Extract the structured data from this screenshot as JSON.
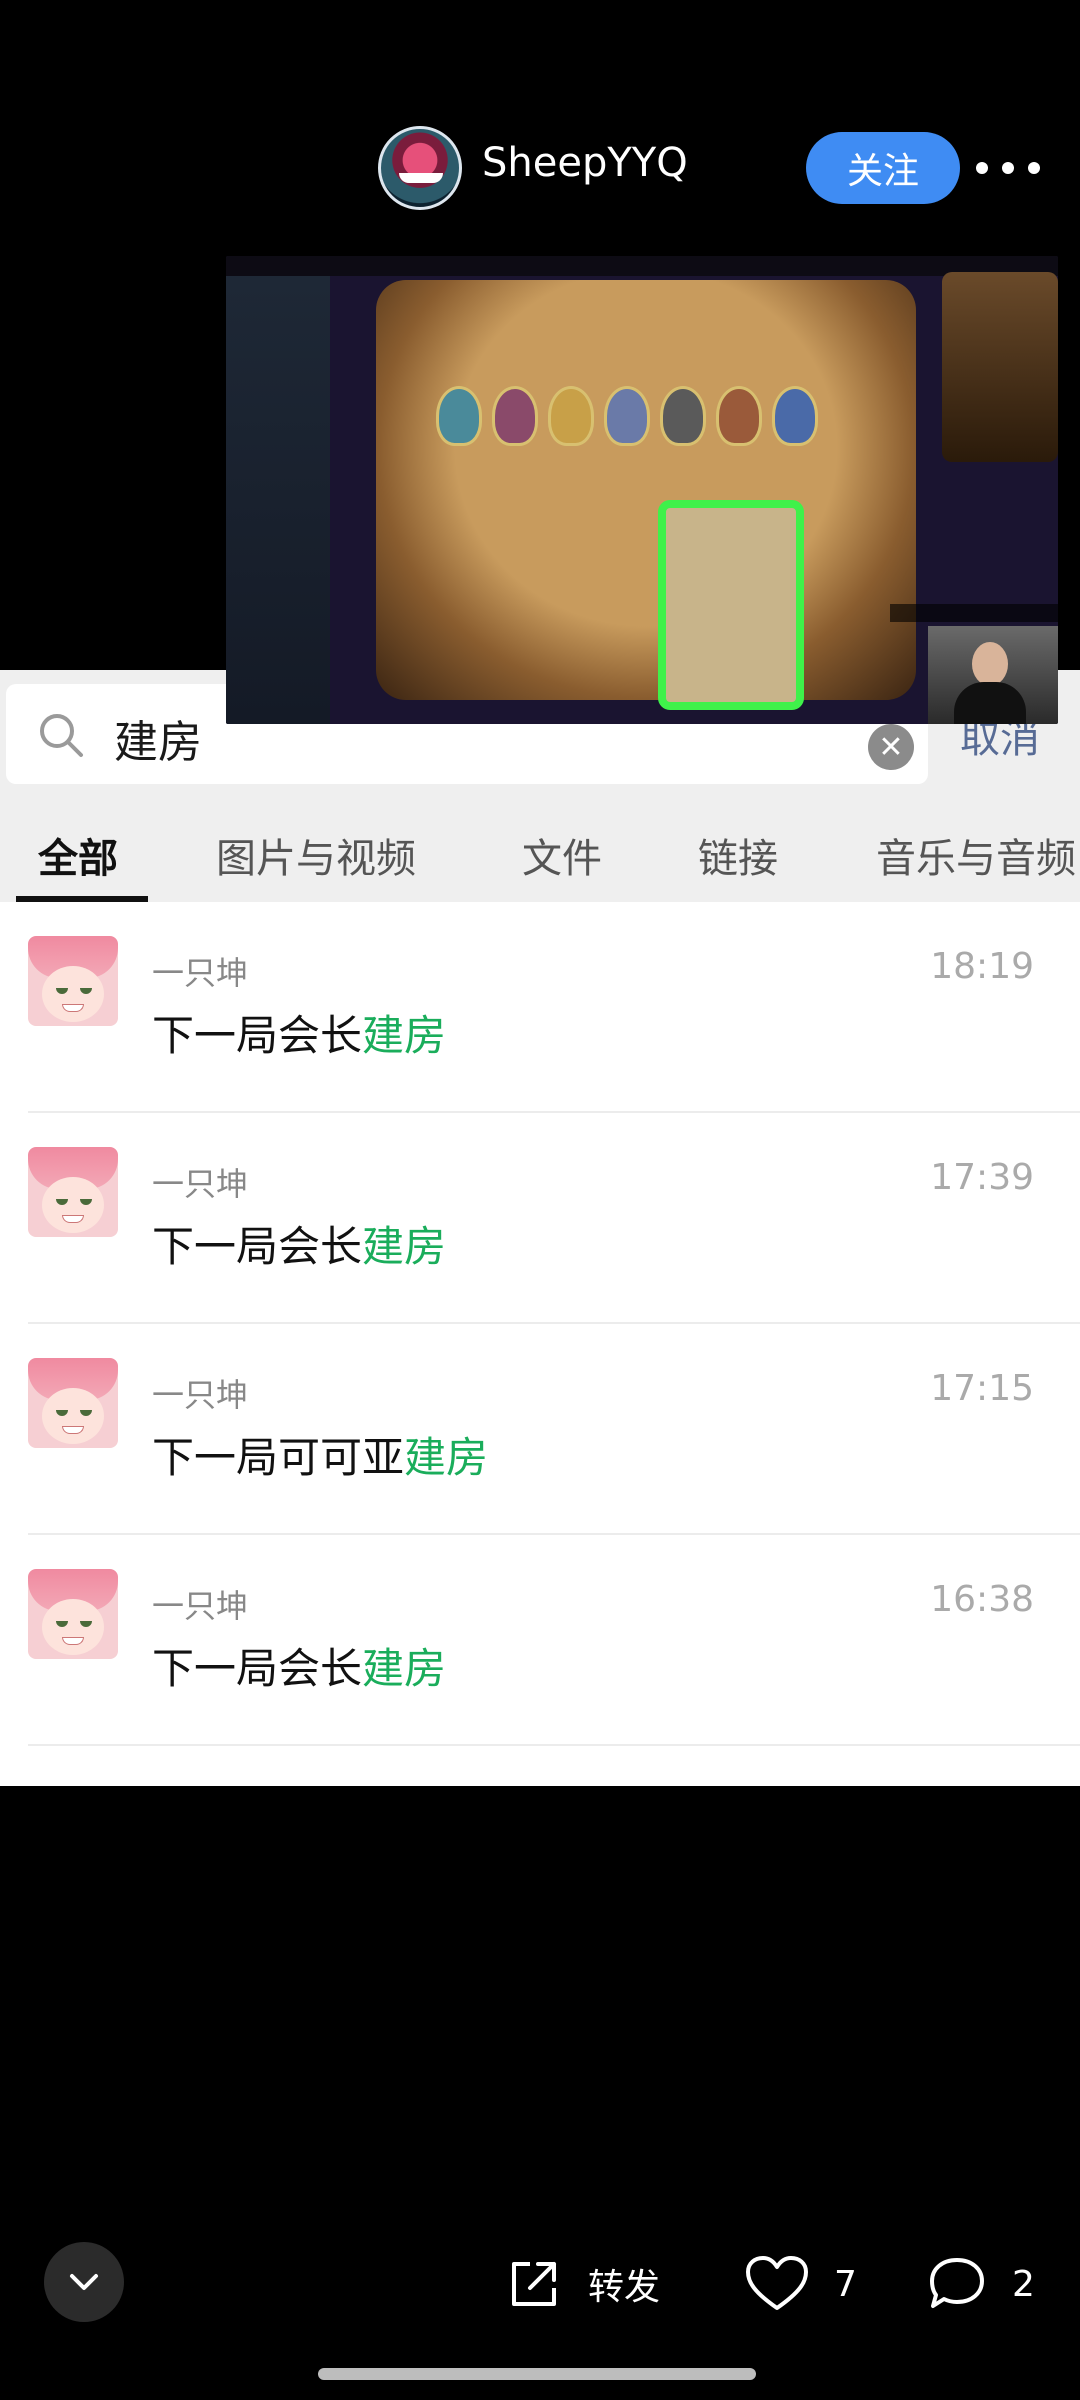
{
  "header": {
    "username": "SheepYYQ",
    "follow_label": "关注"
  },
  "search": {
    "query": "建房",
    "cancel_label": "取消"
  },
  "tabs": [
    {
      "label": "全部",
      "active": true
    },
    {
      "label": "图片与视频",
      "active": false
    },
    {
      "label": "文件",
      "active": false
    },
    {
      "label": "链接",
      "active": false
    },
    {
      "label": "音乐与音频",
      "active": false
    }
  ],
  "results": [
    {
      "sender": "一只坤",
      "time": "18:19",
      "prefix": "下一局会长",
      "highlight": "建房"
    },
    {
      "sender": "一只坤",
      "time": "17:39",
      "prefix": "下一局会长",
      "highlight": "建房"
    },
    {
      "sender": "一只坤",
      "time": "17:15",
      "prefix": "下一局可可亚",
      "highlight": "建房"
    },
    {
      "sender": "一只坤",
      "time": "16:38",
      "prefix": "下一局会长",
      "highlight": "建房"
    }
  ],
  "actions": {
    "forward_label": "转发",
    "like_count": "7",
    "comment_count": "2"
  },
  "colors": {
    "accent": "#3f8cf3",
    "highlight": "#1aad5b",
    "link": "#576b95"
  }
}
